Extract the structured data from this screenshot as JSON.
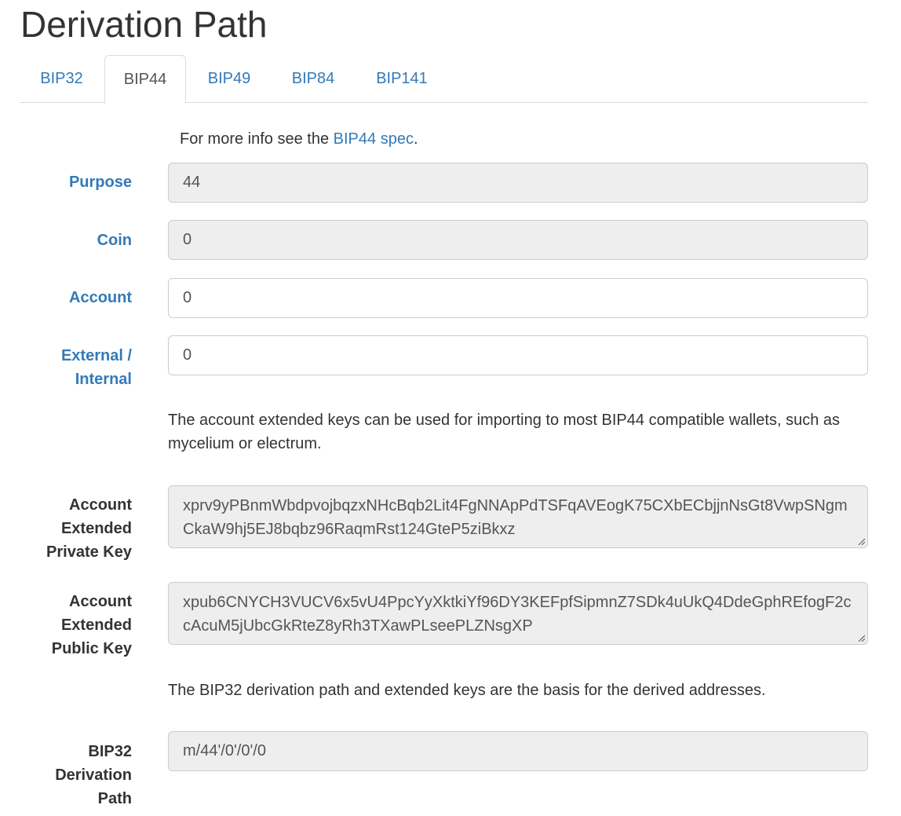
{
  "page": {
    "title": "Derivation Path"
  },
  "tabs": [
    {
      "label": "BIP32",
      "active": false
    },
    {
      "label": "BIP44",
      "active": true
    },
    {
      "label": "BIP49",
      "active": false
    },
    {
      "label": "BIP84",
      "active": false
    },
    {
      "label": "BIP141",
      "active": false
    }
  ],
  "info": {
    "prefix": "For more info see the",
    "link": "BIP44 spec",
    "suffix": "."
  },
  "fields": {
    "purpose": {
      "label": "Purpose",
      "value": "44"
    },
    "coin": {
      "label": "Coin",
      "value": "0"
    },
    "account": {
      "label": "Account",
      "value": "0"
    },
    "change": {
      "label_line1": "External /",
      "label_line2": "Internal",
      "value": "0"
    }
  },
  "help": {
    "extended_keys": "The account extended keys can be used for importing to most BIP44 compatible wallets, such as mycelium or electrum.",
    "derivation": "The BIP32 derivation path and extended keys are the basis for the derived addresses."
  },
  "keys": {
    "private": {
      "label_line1": "Account",
      "label_line2": "Extended",
      "label_line3": "Private Key",
      "value": "xprv9yPBnmWbdpvojbqzxNHcBqb2Lit4FgNNApPdTSFqAVEogK75CXbECbjjnNsGt8VwpSNgmCkaW9hj5EJ8bqbz96RaqmRst124GteP5ziBkxz"
    },
    "public": {
      "label_line1": "Account",
      "label_line2": "Extended",
      "label_line3": "Public Key",
      "value": "xpub6CNYCH3VUCV6x5vU4PpcYyXktkiYf96DY3KEFpfSipmnZ7SDk4uUkQ4DdeGphREfogF2ccAcuM5jUbcGkRteZ8yRh3TXawPLseePLZNsgXP"
    }
  },
  "bip32_path": {
    "label_line1": "BIP32",
    "label_line2": "Derivation",
    "label_line3": "Path",
    "value": "m/44'/0'/0'/0"
  }
}
